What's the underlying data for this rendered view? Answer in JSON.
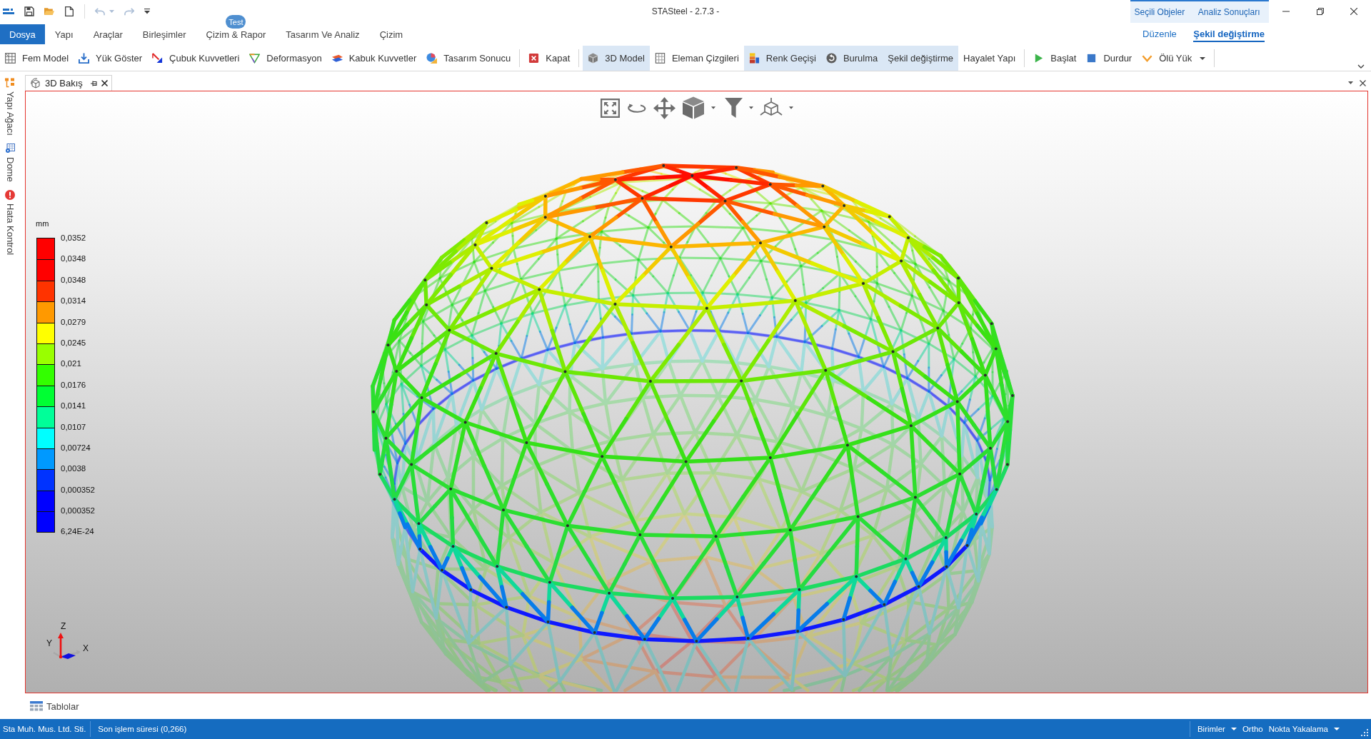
{
  "window": {
    "title": "STASteel - 2.7.3 -"
  },
  "quick_access": [
    {
      "disabled": false
    },
    {
      "disabled": false
    },
    {
      "disabled": false
    },
    {
      "disabled": true
    },
    {
      "disabled": true
    }
  ],
  "ribbon": {
    "tabs": [
      {
        "label": "Dosya",
        "kind": "file",
        "selected": false
      },
      {
        "label": "Yapı",
        "kind": "tab",
        "selected": false
      },
      {
        "label": "Araçlar",
        "kind": "tab",
        "selected": false
      },
      {
        "label": "Birleşimler",
        "kind": "tab",
        "selected": false
      },
      {
        "label": "Çizim & Rapor",
        "kind": "tab",
        "selected": false,
        "badge": "Test"
      },
      {
        "label": "Tasarım Ve Analiz",
        "kind": "tab",
        "selected": false
      },
      {
        "label": "Çizim",
        "kind": "tab",
        "selected": false
      }
    ],
    "context_groups": [
      {
        "title": "Seçili Objeler",
        "tabs": [
          {
            "label": "Düzenle",
            "selected": false
          }
        ]
      },
      {
        "title": "Analiz Sonuçları",
        "tabs": [
          {
            "label": "Şekil değiştirme",
            "selected": true
          }
        ]
      }
    ]
  },
  "toolbar": {
    "groups": [
      {
        "items": [
          {
            "label": "Fem Model",
            "kind": "button",
            "on": false
          },
          {
            "label": "Yük Göster",
            "kind": "button",
            "on": false
          },
          {
            "label": "Çubuk Kuvvetleri",
            "kind": "button",
            "on": false
          },
          {
            "label": "Deformasyon",
            "kind": "button",
            "on": false
          },
          {
            "label": "Kabuk Kuvvetler",
            "kind": "button",
            "on": false
          },
          {
            "label": "Tasarım Sonucu",
            "kind": "button",
            "on": false
          }
        ]
      },
      {
        "items": [
          {
            "label": "Kapat",
            "kind": "button",
            "on": false
          }
        ]
      },
      {
        "items": [
          {
            "label": "3D Model",
            "kind": "button",
            "on": true
          },
          {
            "label": "Eleman Çizgileri",
            "kind": "button",
            "on": false
          },
          {
            "label": "Renk Geçişi",
            "kind": "button",
            "on": true
          },
          {
            "label": "Burulma",
            "kind": "button",
            "on": true
          },
          {
            "label": "Şekil değiştirme",
            "kind": "button",
            "on": true
          },
          {
            "label": "Hayalet Yapı",
            "kind": "button",
            "on": false
          }
        ]
      },
      {
        "items": [
          {
            "label": "Başlat",
            "kind": "button",
            "on": false
          },
          {
            "label": "Durdur",
            "kind": "button",
            "on": false
          },
          {
            "label": "Ölü Yük",
            "kind": "dropdown",
            "on": false
          }
        ]
      }
    ]
  },
  "side_panels": [
    {
      "label": "Yapı Ağacı"
    },
    {
      "label": "Dome"
    },
    {
      "label": "Hata Kontrol"
    }
  ],
  "document_tabs": [
    {
      "label": "3D Bakış",
      "selected": true
    }
  ],
  "viewport": {
    "legend": {
      "unit": "mm",
      "swatches": [
        {
          "color": "#ff0000"
        },
        {
          "color": "#ff0000"
        },
        {
          "color": "#ff3300"
        },
        {
          "color": "#ff9900"
        },
        {
          "color": "#ffff00"
        },
        {
          "color": "#99ff00"
        },
        {
          "color": "#33ff00"
        },
        {
          "color": "#00ff33"
        },
        {
          "color": "#00ff99"
        },
        {
          "color": "#00ffff"
        },
        {
          "color": "#0099ff"
        },
        {
          "color": "#0033ff"
        },
        {
          "color": "#0000ff"
        },
        {
          "color": "#0000ff"
        }
      ],
      "values": [
        "0,0352",
        "0,0348",
        "0,0348",
        "0,0314",
        "0,0279",
        "0,0245",
        "0,021",
        "0,0176",
        "0,0141",
        "0,0107",
        "0,00724",
        "0,0038",
        "0,000352",
        "0,000352",
        "6,24E-24"
      ]
    },
    "axes": [
      "Z",
      "Y",
      "X"
    ]
  },
  "bottom_panels": [
    {
      "label": "Tablolar"
    }
  ],
  "status_bar": {
    "left": [
      "Sta Muh. Mus. Ltd. Sti.",
      "Son işlem süresi (0,266)"
    ],
    "right": [
      {
        "label": "Birimler",
        "kind": "dropdown"
      },
      {
        "label": "Ortho",
        "kind": "button"
      },
      {
        "label": "Nokta Yakalama",
        "kind": "dropdown"
      }
    ]
  }
}
